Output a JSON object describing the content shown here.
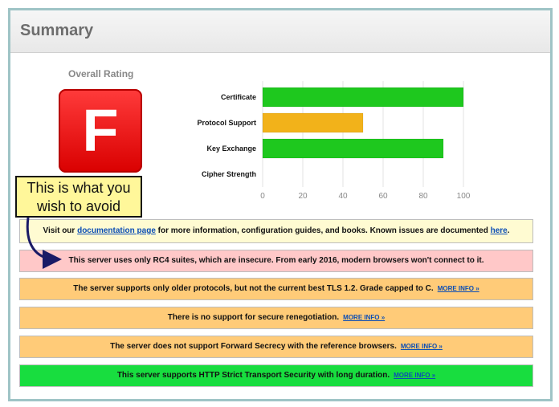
{
  "header": {
    "title": "Summary"
  },
  "rating": {
    "label": "Overall Rating",
    "grade": "F"
  },
  "callout": {
    "line1": "This is what you",
    "line2": "wish to avoid"
  },
  "chart_data": {
    "type": "bar",
    "orientation": "horizontal",
    "categories": [
      "Certificate",
      "Protocol Support",
      "Key Exchange",
      "Cipher Strength"
    ],
    "values": [
      100,
      50,
      90,
      0
    ],
    "colors": [
      "#1ec81e",
      "#f2b21a",
      "#1ec81e",
      "#1ec81e"
    ],
    "ticks": [
      0,
      20,
      40,
      60,
      80,
      100
    ],
    "xlim": [
      0,
      100
    ],
    "grid": true
  },
  "boxes": {
    "doc": {
      "prefix": "Visit our ",
      "link": "documentation page",
      "middle": " for more information, configuration guides, and books. Known issues are documented ",
      "link2": "here",
      "suffix": "."
    },
    "rc4": {
      "text": "This server uses only RC4 suites, which are insecure. From early 2016, modern browsers won't connect to it."
    },
    "proto": {
      "text": "The server supports only older protocols, but not the current best TLS 1.2. Grade capped to C.",
      "more": "MORE INFO »"
    },
    "reneg": {
      "text": "There is no support for secure renegotiation.",
      "more": "MORE INFO »"
    },
    "fs": {
      "text": "The server does not support Forward Secrecy with the reference browsers.",
      "more": "MORE INFO »"
    },
    "hsts": {
      "text": "This server supports HTTP Strict Transport Security with long duration.",
      "more": "MORE INFO »"
    }
  }
}
